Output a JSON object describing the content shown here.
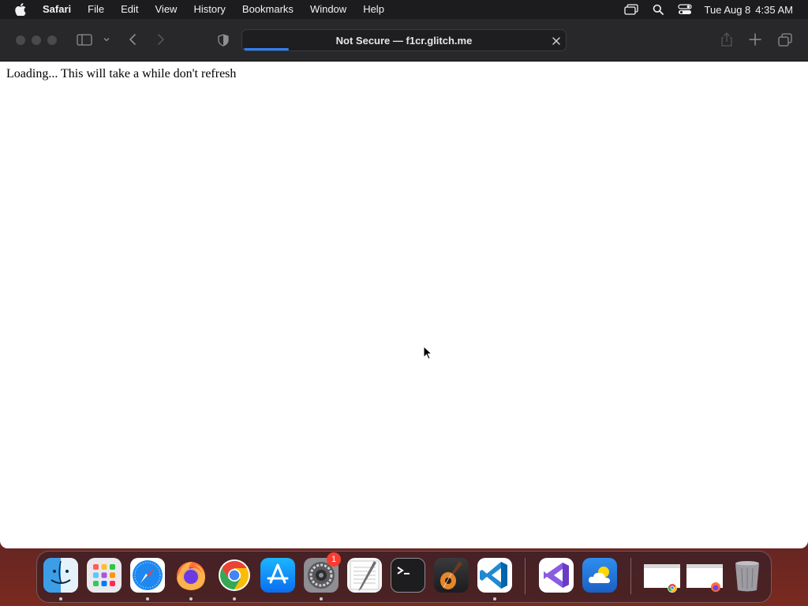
{
  "menubar": {
    "apple_icon": "apple-logo-icon",
    "app_name": "Safari",
    "items": [
      "File",
      "Edit",
      "View",
      "History",
      "Bookmarks",
      "Window",
      "Help"
    ],
    "status_icons": [
      "screen-mirroring-icon",
      "spotlight-search-icon",
      "control-center-icon"
    ],
    "clock_date": "Tue Aug 8",
    "clock_time": "4:35 AM"
  },
  "safari": {
    "address": "Not Secure — f1cr.glitch.me",
    "load_progress": 0.14,
    "toolbar_icons": [
      "sidebar-icon",
      "chevron-down-icon",
      "back-icon",
      "forward-icon",
      "privacy-shield-icon",
      "share-icon",
      "new-tab-icon",
      "tab-overview-icon"
    ]
  },
  "page": {
    "text": "Loading... This will take a while don't refresh"
  },
  "dock": {
    "apps": [
      {
        "name": "Finder",
        "icon": "finder-icon",
        "running": true
      },
      {
        "name": "Launchpad",
        "icon": "launchpad-icon",
        "running": false
      },
      {
        "name": "Safari",
        "icon": "safari-icon",
        "running": true
      },
      {
        "name": "Firefox",
        "icon": "firefox-icon",
        "running": true
      },
      {
        "name": "Chrome",
        "icon": "chrome-icon",
        "running": true
      },
      {
        "name": "App Store",
        "icon": "app-store-icon",
        "running": false
      },
      {
        "name": "System Settings",
        "icon": "system-settings-icon",
        "running": true,
        "badge": "1"
      },
      {
        "name": "TextEdit",
        "icon": "textedit-icon",
        "running": false
      },
      {
        "name": "Terminal",
        "icon": "terminal-icon",
        "running": false
      },
      {
        "name": "GarageBand",
        "icon": "garageband-icon",
        "running": false
      },
      {
        "name": "Visual Studio Code",
        "icon": "vscode-icon",
        "running": true
      },
      {
        "name": "Visual Studio",
        "icon": "visual-studio-icon",
        "running": false
      },
      {
        "name": "Weather",
        "icon": "weather-icon",
        "running": false
      }
    ],
    "minimized": [
      "chrome-window-thumbnail",
      "firefox-window-thumbnail"
    ],
    "trash": "trash-icon"
  }
}
